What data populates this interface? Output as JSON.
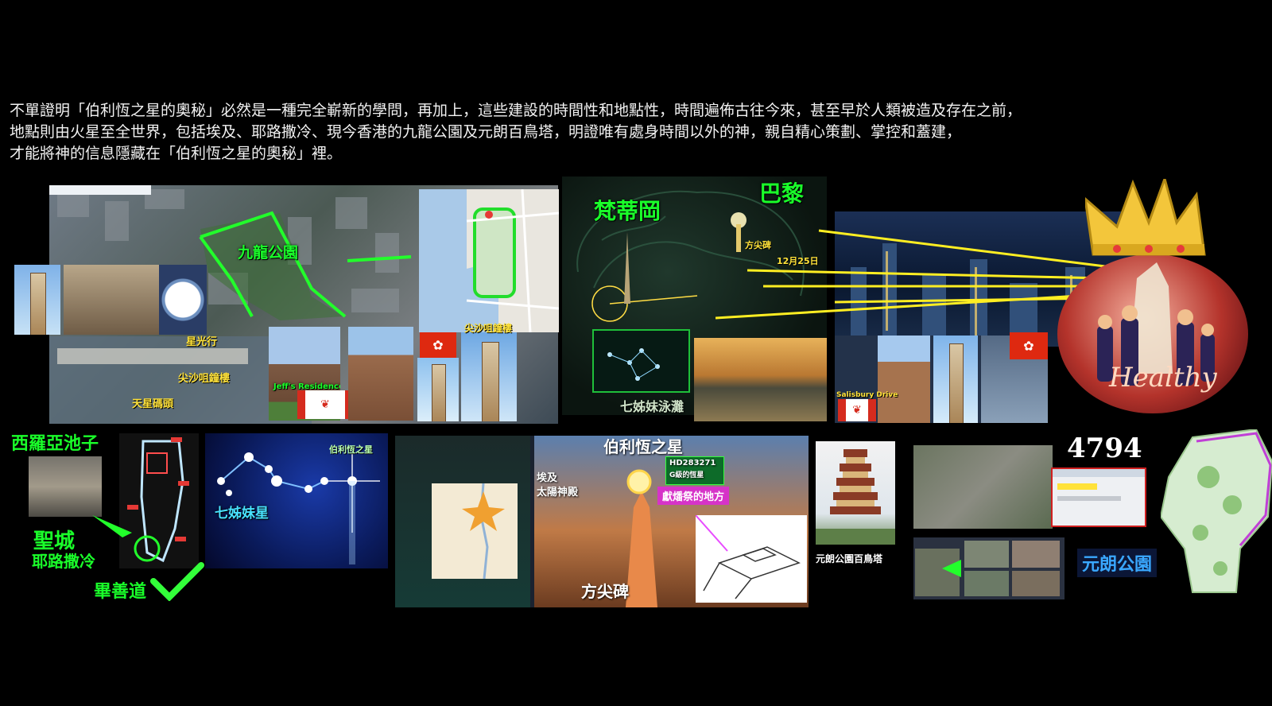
{
  "intro": {
    "line1": "不單證明「伯利恆之星的奧秘」必然是一種完全嶄新的學問，再加上，這些建設的時間性和地點性，時間遍佈古往今來，甚至早於人類被造及存在之前，",
    "line2": "地點則由火星至全世界，包括埃及、耶路撒冷、現今香港的九龍公園及元朗百鳥塔，明證唯有處身時間以外的神，親自精心策劃、掌控和蓋建，",
    "line3": "才能將神的信息隱藏在「伯利恆之星的奧秘」裡。"
  },
  "kowloon": {
    "park_label": "九龍公園",
    "star_ferry_label": "天星碼頭",
    "clock_tower_label": "尖沙咀鐘樓",
    "clock_tower_label2": "尖沙咀鐘樓",
    "star_street_label": "星光行",
    "jeff_residence": "Jeff's Residence"
  },
  "middle_top": {
    "vatican": "梵蒂岡",
    "paris": "巴黎",
    "obelisk": "方尖碑",
    "date": "12月25日",
    "pleiades_pool": "七姊妹泳灘",
    "salisbury": "Salisbury Drive"
  },
  "right_top": {
    "healthy": "Healthy"
  },
  "bottom": {
    "siloam": "西羅亞池子",
    "holy_city": "聖城",
    "jerusalem": "耶路撒冷",
    "good_way": "畢善道",
    "pleiades": "七姊妹星",
    "bethlehem_star_small": "伯利恆之星",
    "bethlehem_star": "伯利恆之星",
    "hd_code": "HD283271",
    "hd_sub": "G級的恆星",
    "egypt": "埃及",
    "sun_temple": "太陽神殿",
    "sacrifice_place": "獻燔祭的地方",
    "obelisk": "方尖碑",
    "yuen_long_tower": "元朗公園百鳥塔",
    "number": "4794",
    "yuen_long_park": "元朗公園"
  },
  "colors": {
    "highlight_green": "#1aff2a",
    "highlight_yellow": "#ffe23a",
    "magenta": "#e84cff"
  }
}
